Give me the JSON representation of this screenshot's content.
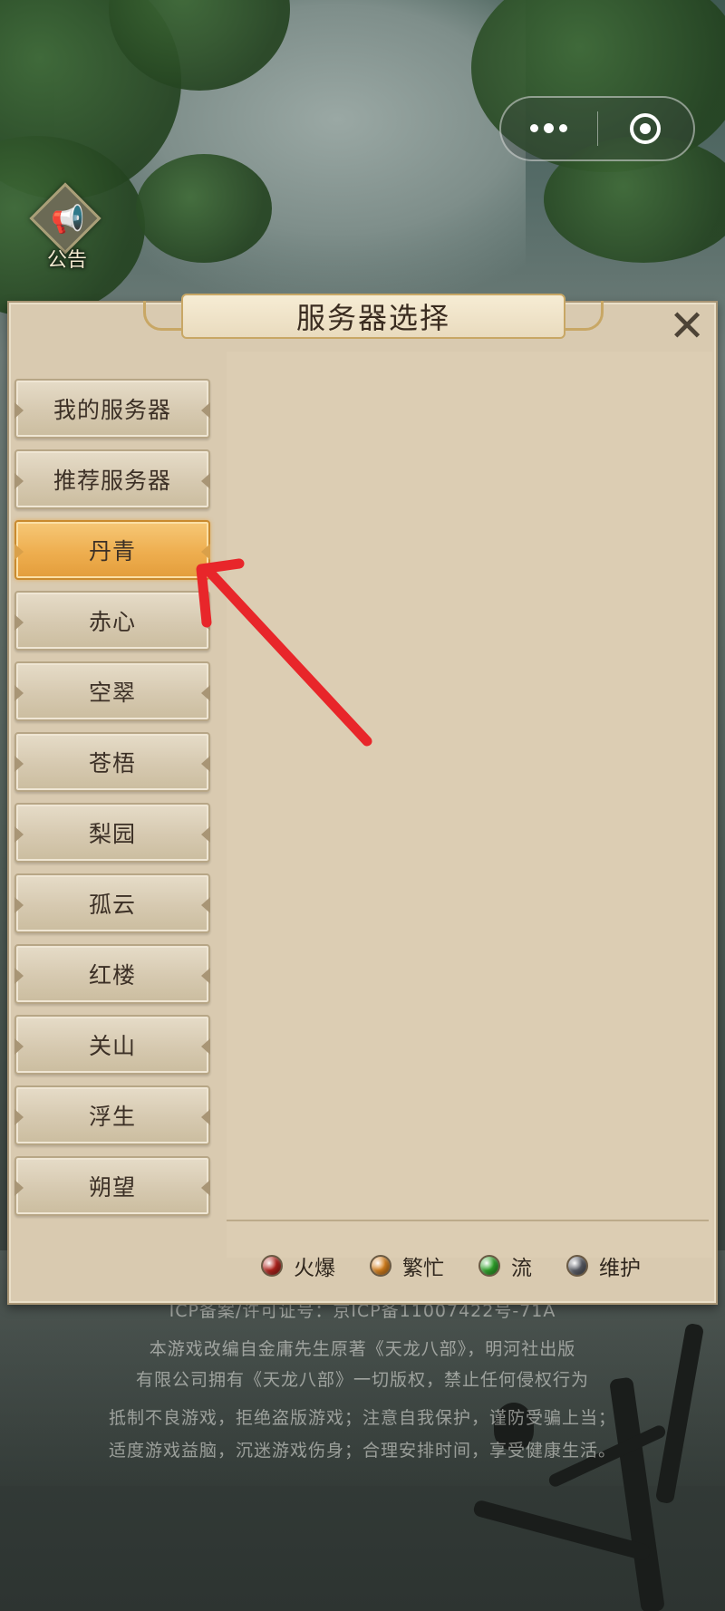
{
  "capsule": {
    "more_icon": "ellipsis-icon",
    "close_icon": "target-icon"
  },
  "announcement": {
    "label": "公告",
    "icon": "megaphone-icon"
  },
  "dialog": {
    "title": "服务器选择",
    "close_icon": "close-x-icon",
    "servers": [
      {
        "label": "我的服务器",
        "selected": false
      },
      {
        "label": "推荐服务器",
        "selected": false
      },
      {
        "label": "丹青",
        "selected": true
      },
      {
        "label": "赤心",
        "selected": false
      },
      {
        "label": "空翠",
        "selected": false
      },
      {
        "label": "苍梧",
        "selected": false
      },
      {
        "label": "梨园",
        "selected": false
      },
      {
        "label": "孤云",
        "selected": false
      },
      {
        "label": "红楼",
        "selected": false
      },
      {
        "label": "关山",
        "selected": false
      },
      {
        "label": "浮生",
        "selected": false
      },
      {
        "label": "朔望",
        "selected": false
      }
    ],
    "legend": [
      {
        "label": "火爆",
        "color": "#b3231c"
      },
      {
        "label": "繁忙",
        "color": "#d9821e"
      },
      {
        "label": "流",
        "color": "#2fa52a"
      },
      {
        "label": "维护",
        "color": "#5a5d66"
      }
    ]
  },
  "footer": {
    "icp": "ICP备案/许可证号：京ICP备11007422号-71A",
    "lines": [
      "本游戏改编自金庸先生原著《天龙八部》，明河社出版",
      "有限公司拥有《天龙八部》一切版权，禁止任何侵权行为",
      "抵制不良游戏，拒绝盗版游戏；注意自我保护，谨防受骗上当；",
      "适度游戏益脑，沉迷游戏伤身；合理安排时间，享受健康生活。"
    ]
  },
  "annotation": {
    "arrow_color": "#e8262a"
  }
}
